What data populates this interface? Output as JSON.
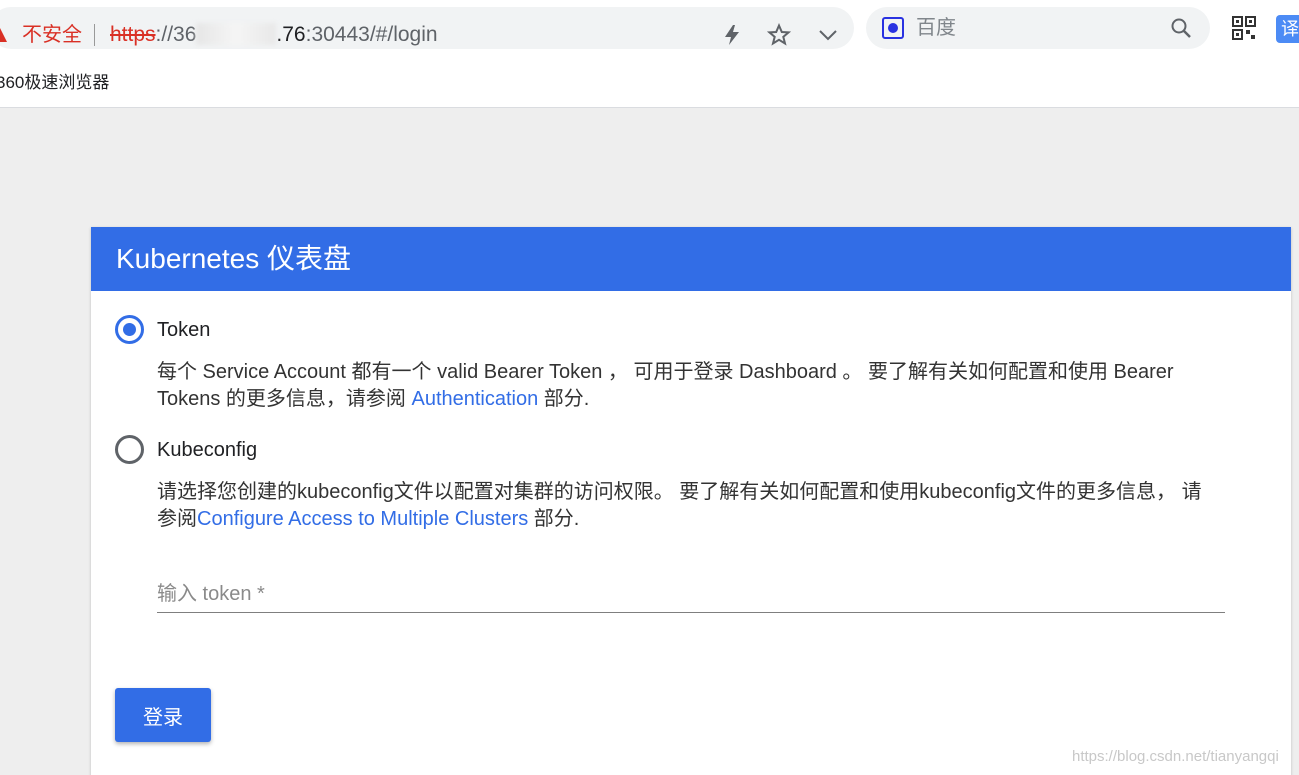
{
  "browser": {
    "security_label": "不安全",
    "url_scheme": "https",
    "url_host_start": "://36",
    "url_host_end": ".76",
    "url_rest": ":30443/#/login",
    "search_placeholder": "百度",
    "bookmark": "360极速浏览器",
    "translate_label": "译"
  },
  "card": {
    "title": "Kubernetes 仪表盘",
    "options": [
      {
        "label": "Token",
        "checked": true,
        "desc_before": "每个 Service Account 都有一个 valid Bearer Token ， 可用于登录 Dashboard 。 要了解有关如何配置和使用 Bearer Tokens 的更多信息，请参阅 ",
        "link": "Authentication",
        "desc_after": " 部分."
      },
      {
        "label": "Kubeconfig",
        "checked": false,
        "desc_before": "请选择您创建的kubeconfig文件以配置对集群的访问权限。 要了解有关如何配置和使用kubeconfig文件的更多信息， 请参阅",
        "link": "Configure Access to Multiple Clusters",
        "desc_after": " 部分."
      }
    ],
    "token_placeholder": "输入 token *",
    "login_label": "登录"
  },
  "watermark": "https://blog.csdn.net/tianyangqi",
  "colors": {
    "accent": "#326de6",
    "warning": "#d93025"
  }
}
